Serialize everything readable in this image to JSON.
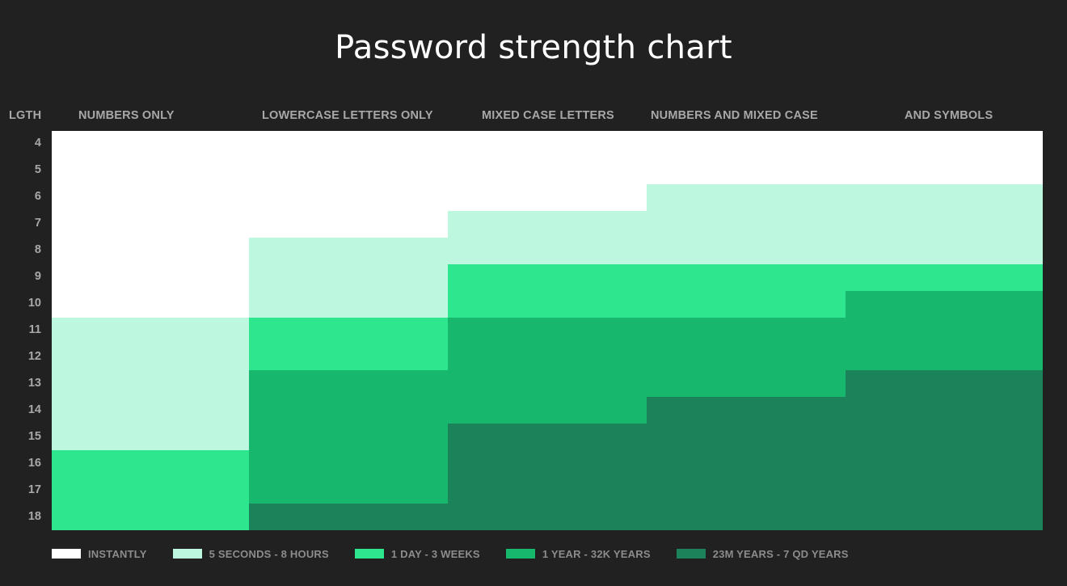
{
  "chart_data": {
    "type": "heatmap",
    "title": "Password strength chart",
    "y_axis_label": "LGTH",
    "lengths": [
      4,
      5,
      6,
      7,
      8,
      9,
      10,
      11,
      12,
      13,
      14,
      15,
      16,
      17,
      18
    ],
    "categories": [
      "NUMBERS ONLY",
      "LOWERCASE LETTERS ONLY",
      "MIXED CASE LETTERS",
      "NUMBERS AND MIXED CASE",
      "AND SYMBOLS"
    ],
    "levels": [
      {
        "label": "INSTANTLY",
        "color": "#ffffff"
      },
      {
        "label": "5 SECONDS - 8 HOURS",
        "color": "#bdf7e0"
      },
      {
        "label": "1 DAY - 3 WEEKS",
        "color": "#2ee68e"
      },
      {
        "label": "1 YEAR - 32K YEARS",
        "color": "#17b86e"
      },
      {
        "label": "23M YEARS - 7 QD YEARS",
        "color": "#1c8259"
      }
    ],
    "series": [
      {
        "name": "NUMBERS ONLY",
        "values": [
          0,
          0,
          0,
          0,
          0,
          0,
          0,
          1,
          1,
          1,
          1,
          1,
          2,
          2,
          2
        ]
      },
      {
        "name": "LOWERCASE LETTERS ONLY",
        "values": [
          0,
          0,
          0,
          0,
          1,
          1,
          1,
          2,
          2,
          3,
          3,
          3,
          3,
          3,
          4
        ]
      },
      {
        "name": "MIXED CASE LETTERS",
        "values": [
          0,
          0,
          0,
          1,
          1,
          2,
          2,
          3,
          3,
          3,
          3,
          4,
          4,
          4,
          4
        ]
      },
      {
        "name": "NUMBERS AND MIXED CASE",
        "values": [
          0,
          0,
          1,
          1,
          1,
          2,
          2,
          3,
          3,
          3,
          4,
          4,
          4,
          4,
          4
        ]
      },
      {
        "name": "AND SYMBOLS",
        "values": [
          0,
          0,
          1,
          1,
          1,
          2,
          3,
          3,
          3,
          4,
          4,
          4,
          4,
          4,
          4
        ]
      }
    ],
    "legend_position": "bottom-left",
    "grid": false
  }
}
